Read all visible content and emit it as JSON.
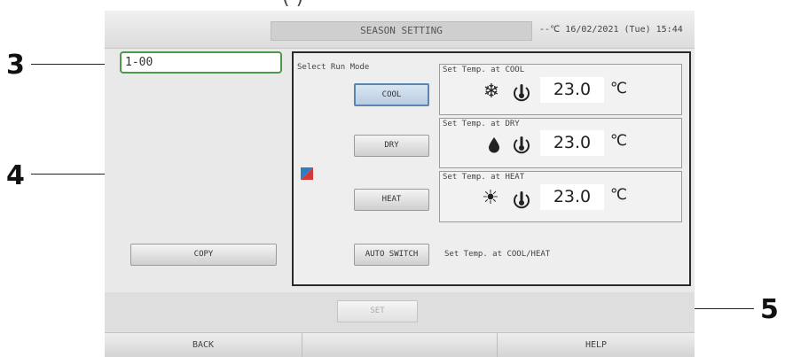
{
  "top_caption": "(                                                                                                    )",
  "callouts": [
    "3",
    "4",
    "5"
  ],
  "header": {
    "title": "SEASON SETTING",
    "status": "--℃ 16/02/2021 (Tue) 15:44"
  },
  "group": {
    "value": "1-00"
  },
  "copy_label": "COPY",
  "run_mode": {
    "label": "Select Run Mode",
    "buttons": [
      {
        "label": "COOL",
        "selected": true
      },
      {
        "label": "DRY"
      },
      {
        "label": "HEAT"
      },
      {
        "label": "AUTO SWITCH"
      }
    ]
  },
  "temps": [
    {
      "label": "Set Temp. at COOL",
      "icon": "snowflake-icon",
      "value": "23.0",
      "unit": "℃"
    },
    {
      "label": "Set Temp. at DRY",
      "icon": "droplet-icon",
      "value": "23.0",
      "unit": "℃"
    },
    {
      "label": "Set Temp. at HEAT",
      "icon": "sun-icon",
      "value": "23.0",
      "unit": "℃"
    }
  ],
  "auto_label": "Set Temp. at COOL/HEAT",
  "set_label": "SET",
  "nav": {
    "back": "BACK",
    "middle": "",
    "help": "HELP"
  },
  "colors": {
    "accent_green": "#4a9a4a",
    "selected_blue": "#5a86b0",
    "indicator_blue": "#2f7fc0",
    "indicator_red": "#d33a3a"
  }
}
